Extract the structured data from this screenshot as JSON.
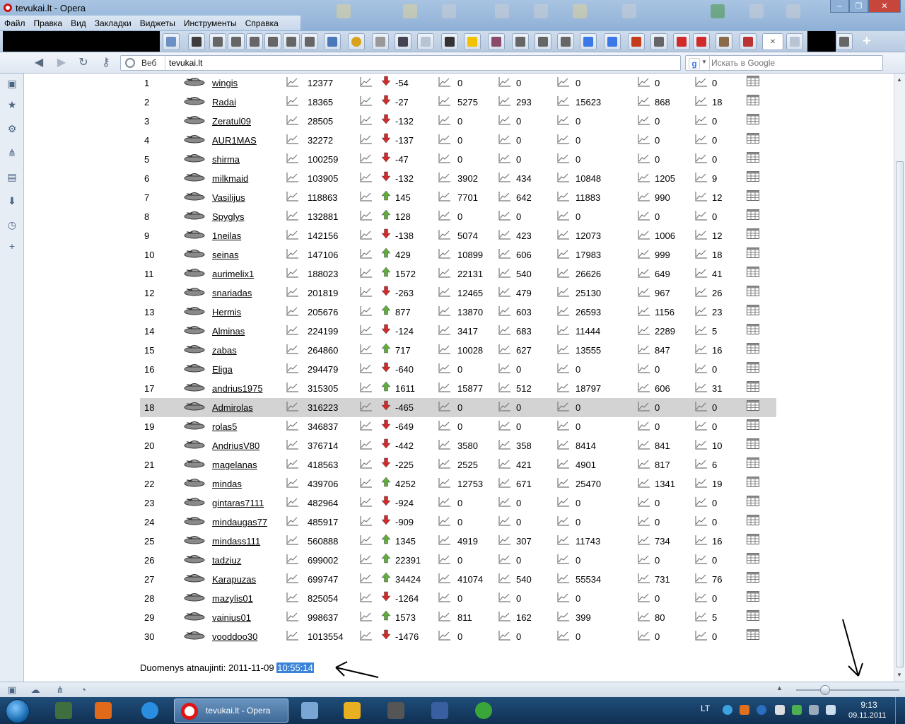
{
  "window": {
    "title": "tevukai.lt - Opera",
    "controls": [
      "–",
      "❐",
      "✕"
    ]
  },
  "menu": [
    "Файл",
    "Правка",
    "Вид",
    "Закладки",
    "Виджеты",
    "Инструменты",
    "Справка"
  ],
  "address": {
    "label": "Веб",
    "url": "tevukai.lt",
    "search_placeholder": "Искать в Google"
  },
  "colors": {
    "arrow_down": "#d22a2a",
    "arrow_up": "#5fae3c",
    "highlight_row": "#d3d3d3",
    "selection": "#3a83d8"
  },
  "rows": [
    {
      "rank": "1",
      "player": "wingis",
      "c1": "12377",
      "dir": "down",
      "c2": "-54",
      "c3": "0",
      "c4": "0",
      "c5": "0",
      "c6": "0",
      "c7": "0"
    },
    {
      "rank": "2",
      "player": "Radai",
      "c1": "18365",
      "dir": "down",
      "c2": "-27",
      "c3": "5275",
      "c4": "293",
      "c5": "15623",
      "c6": "868",
      "c7": "18"
    },
    {
      "rank": "3",
      "player": "Zeratul09",
      "c1": "28505",
      "dir": "down",
      "c2": "-132",
      "c3": "0",
      "c4": "0",
      "c5": "0",
      "c6": "0",
      "c7": "0"
    },
    {
      "rank": "4",
      "player": "AUR1MAS",
      "c1": "32272",
      "dir": "down",
      "c2": "-137",
      "c3": "0",
      "c4": "0",
      "c5": "0",
      "c6": "0",
      "c7": "0"
    },
    {
      "rank": "5",
      "player": "shirma",
      "c1": "100259",
      "dir": "down",
      "c2": "-47",
      "c3": "0",
      "c4": "0",
      "c5": "0",
      "c6": "0",
      "c7": "0"
    },
    {
      "rank": "6",
      "player": "milkmaid",
      "c1": "103905",
      "dir": "down",
      "c2": "-132",
      "c3": "3902",
      "c4": "434",
      "c5": "10848",
      "c6": "1205",
      "c7": "9"
    },
    {
      "rank": "7",
      "player": "Vasilijus",
      "c1": "118863",
      "dir": "up",
      "c2": "145",
      "c3": "7701",
      "c4": "642",
      "c5": "11883",
      "c6": "990",
      "c7": "12"
    },
    {
      "rank": "8",
      "player": "Spyglys",
      "c1": "132881",
      "dir": "up",
      "c2": "128",
      "c3": "0",
      "c4": "0",
      "c5": "0",
      "c6": "0",
      "c7": "0"
    },
    {
      "rank": "9",
      "player": "1neilas",
      "c1": "142156",
      "dir": "down",
      "c2": "-138",
      "c3": "5074",
      "c4": "423",
      "c5": "12073",
      "c6": "1006",
      "c7": "12"
    },
    {
      "rank": "10",
      "player": "seinas",
      "c1": "147106",
      "dir": "up",
      "c2": "429",
      "c3": "10899",
      "c4": "606",
      "c5": "17983",
      "c6": "999",
      "c7": "18"
    },
    {
      "rank": "11",
      "player": "aurimelix1",
      "c1": "188023",
      "dir": "up",
      "c2": "1572",
      "c3": "22131",
      "c4": "540",
      "c5": "26626",
      "c6": "649",
      "c7": "41"
    },
    {
      "rank": "12",
      "player": "snariadas",
      "c1": "201819",
      "dir": "down",
      "c2": "-263",
      "c3": "12465",
      "c4": "479",
      "c5": "25130",
      "c6": "967",
      "c7": "26"
    },
    {
      "rank": "13",
      "player": "Hermis",
      "c1": "205676",
      "dir": "up",
      "c2": "877",
      "c3": "13870",
      "c4": "603",
      "c5": "26593",
      "c6": "1156",
      "c7": "23"
    },
    {
      "rank": "14",
      "player": "Alminas",
      "c1": "224199",
      "dir": "down",
      "c2": "-124",
      "c3": "3417",
      "c4": "683",
      "c5": "11444",
      "c6": "2289",
      "c7": "5"
    },
    {
      "rank": "15",
      "player": "zabas",
      "c1": "264860",
      "dir": "up",
      "c2": "717",
      "c3": "10028",
      "c4": "627",
      "c5": "13555",
      "c6": "847",
      "c7": "16"
    },
    {
      "rank": "16",
      "player": "Eliga",
      "c1": "294479",
      "dir": "down",
      "c2": "-640",
      "c3": "0",
      "c4": "0",
      "c5": "0",
      "c6": "0",
      "c7": "0"
    },
    {
      "rank": "17",
      "player": "andrius1975",
      "c1": "315305",
      "dir": "up",
      "c2": "1611",
      "c3": "15877",
      "c4": "512",
      "c5": "18797",
      "c6": "606",
      "c7": "31"
    },
    {
      "rank": "18",
      "player": "Admirolas",
      "c1": "316223",
      "dir": "down",
      "c2": "-465",
      "c3": "0",
      "c4": "0",
      "c5": "0",
      "c6": "0",
      "c7": "0",
      "highlight": true
    },
    {
      "rank": "19",
      "player": "rolas5",
      "c1": "346837",
      "dir": "down",
      "c2": "-649",
      "c3": "0",
      "c4": "0",
      "c5": "0",
      "c6": "0",
      "c7": "0"
    },
    {
      "rank": "20",
      "player": "AndriusV80",
      "c1": "376714",
      "dir": "down",
      "c2": "-442",
      "c3": "3580",
      "c4": "358",
      "c5": "8414",
      "c6": "841",
      "c7": "10"
    },
    {
      "rank": "21",
      "player": "magelanas",
      "c1": "418563",
      "dir": "down",
      "c2": "-225",
      "c3": "2525",
      "c4": "421",
      "c5": "4901",
      "c6": "817",
      "c7": "6"
    },
    {
      "rank": "22",
      "player": "mindas",
      "c1": "439706",
      "dir": "up",
      "c2": "4252",
      "c3": "12753",
      "c4": "671",
      "c5": "25470",
      "c6": "1341",
      "c7": "19"
    },
    {
      "rank": "23",
      "player": "gintaras7111",
      "c1": "482964",
      "dir": "down",
      "c2": "-924",
      "c3": "0",
      "c4": "0",
      "c5": "0",
      "c6": "0",
      "c7": "0"
    },
    {
      "rank": "24",
      "player": "mindaugas77",
      "c1": "485917",
      "dir": "down",
      "c2": "-909",
      "c3": "0",
      "c4": "0",
      "c5": "0",
      "c6": "0",
      "c7": "0"
    },
    {
      "rank": "25",
      "player": "mindass111",
      "c1": "560888",
      "dir": "up",
      "c2": "1345",
      "c3": "4919",
      "c4": "307",
      "c5": "11743",
      "c6": "734",
      "c7": "16"
    },
    {
      "rank": "26",
      "player": "tadziuz",
      "c1": "699002",
      "dir": "up",
      "c2": "22391",
      "c3": "0",
      "c4": "0",
      "c5": "0",
      "c6": "0",
      "c7": "0"
    },
    {
      "rank": "27",
      "player": "Karapuzas",
      "c1": "699747",
      "dir": "up",
      "c2": "34424",
      "c3": "41074",
      "c4": "540",
      "c5": "55534",
      "c6": "731",
      "c7": "76"
    },
    {
      "rank": "28",
      "player": "mazylis01",
      "c1": "825054",
      "dir": "down",
      "c2": "-1264",
      "c3": "0",
      "c4": "0",
      "c5": "0",
      "c6": "0",
      "c7": "0"
    },
    {
      "rank": "29",
      "player": "vainius01",
      "c1": "998637",
      "dir": "up",
      "c2": "1573",
      "c3": "811",
      "c4": "162",
      "c5": "399",
      "c6": "80",
      "c7": "5"
    },
    {
      "rank": "30",
      "player": "vooddoo30",
      "c1": "1013554",
      "dir": "down",
      "c2": "-1476",
      "c3": "0",
      "c4": "0",
      "c5": "0",
      "c6": "0",
      "c7": "0"
    }
  ],
  "footer": {
    "label": "Duomenys atnaujinti: 2011-11-09",
    "time": "10:55:14"
  },
  "taskbar": {
    "opera_label": "tevukai.lt - Opera",
    "lang": "LT",
    "clock_time": "9:13",
    "clock_date": "09.11.2011"
  }
}
